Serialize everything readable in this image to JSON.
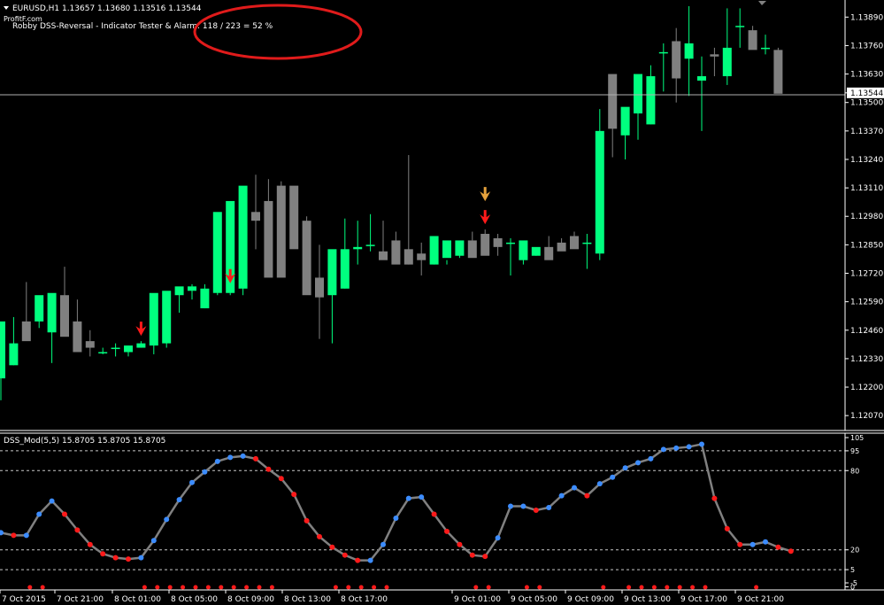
{
  "header": {
    "symbol_info": "EURUSD,H1  1.13657 1.13680 1.13516 1.13544",
    "watermark": "ProfitF.com",
    "indicator_text": "Robby DSS-Reversal - Indicator Tester & Alarm: 118 / 223 = 52 %"
  },
  "price_axis": {
    "labels": [
      "1.13890",
      "1.13760",
      "1.13630",
      "1.13544",
      "1.13500",
      "1.13370",
      "1.13240",
      "1.13110",
      "1.12980",
      "1.12850",
      "1.12720",
      "1.12590",
      "1.12460",
      "1.12330",
      "1.12200",
      "1.12070"
    ],
    "current_price": "1.13544"
  },
  "sub_window": {
    "title": "DSS_Mod(5,5) 15.8705 15.8705 15.8705",
    "level_labels": [
      "105",
      "95",
      "80",
      "20",
      "5",
      "-5",
      "0"
    ]
  },
  "time_axis": {
    "labels": [
      "7 Oct 2015",
      "7 Oct 21:00",
      "8 Oct 01:00",
      "8 Oct 05:00",
      "8 Oct 09:00",
      "8 Oct 13:00",
      "8 Oct 17:00",
      "9 Oct 01:00",
      "9 Oct 05:00",
      "9 Oct 09:00",
      "9 Oct 13:00",
      "9 Oct 17:00",
      "9 Oct 21:00"
    ]
  },
  "colors": {
    "background": "#000000",
    "bull": "#00ff7f",
    "bear": "#808080",
    "arrow_red": "#ff1a1a",
    "arrow_orange": "#e6a23c",
    "dss_line": "#808080",
    "dss_up": "#3c8cff",
    "dss_down": "#ff1a1a",
    "annotation_circle": "#e01b1b"
  },
  "chart_data": [
    {
      "type": "candlestick",
      "series": [
        {
          "open": [
            1.1224,
            1.123,
            1.125,
            1.125,
            1.1245,
            1.1262,
            1.125,
            1.1241,
            1.1236,
            1.1238,
            1.1236,
            1.1238,
            1.1239,
            1.124,
            1.1262,
            1.1264,
            1.1256,
            1.1263,
            1.1263,
            1.1265,
            1.13,
            1.1305,
            1.1312,
            1.1312,
            1.1296,
            1.127,
            1.1262,
            1.1265,
            1.1283,
            1.1285,
            1.1282,
            1.1287,
            1.1283,
            1.1281,
            1.1276,
            1.1279,
            1.128,
            1.1287,
            1.129,
            1.1288,
            1.1286,
            1.1278,
            1.128,
            1.1284,
            1.1286,
            1.1289,
            1.1286,
            1.1281,
            1.1363,
            1.1335,
            1.1345,
            1.134,
            1.1373,
            1.1378,
            1.137,
            1.136,
            1.1372,
            1.1362,
            1.1385,
            1.1383,
            1.1375,
            1.1374
          ],
          "high": [
            1.1232,
            1.1252,
            1.1268,
            1.1258,
            1.1254,
            1.1275,
            1.126,
            1.1246,
            1.1238,
            1.124,
            1.1239,
            1.1241,
            1.124,
            1.1244,
            1.1264,
            1.1267,
            1.1267,
            1.1266,
            1.1265,
            1.1311,
            1.1317,
            1.1315,
            1.1314,
            1.1306,
            1.1298,
            1.1285,
            1.1275,
            1.1297,
            1.1296,
            1.1299,
            1.1296,
            1.1291,
            1.1326,
            1.1286,
            1.1283,
            1.1278,
            1.1283,
            1.1291,
            1.1292,
            1.129,
            1.1288,
            1.1283,
            1.1283,
            1.1289,
            1.1288,
            1.1291,
            1.129,
            1.1347,
            1.1355,
            1.1345,
            1.1347,
            1.1367,
            1.1377,
            1.1384,
            1.1394,
            1.1371,
            1.1375,
            1.1393,
            1.1393,
            1.1385,
            1.1381,
            1.1375
          ],
          "low": [
            1.1214,
            1.123,
            1.1244,
            1.1247,
            1.1231,
            1.1258,
            1.124,
            1.1234,
            1.1235,
            1.1234,
            1.1234,
            1.1238,
            1.1235,
            1.1238,
            1.1254,
            1.126,
            1.1256,
            1.1262,
            1.1262,
            1.1262,
            1.1283,
            1.1293,
            1.1296,
            1.1302,
            1.1285,
            1.1242,
            1.124,
            1.1265,
            1.1276,
            1.1282,
            1.128,
            1.1283,
            1.1276,
            1.1271,
            1.1276,
            1.1276,
            1.1279,
            1.1287,
            1.1284,
            1.128,
            1.1271,
            1.1276,
            1.128,
            1.1281,
            1.1284,
            1.1286,
            1.1274,
            1.1278,
            1.1325,
            1.1324,
            1.1333,
            1.134,
            1.1355,
            1.135,
            1.1353,
            1.1337,
            1.1362,
            1.1358,
            1.1375,
            1.1375,
            1.1372,
            1.1355
          ],
          "close": [
            1.125,
            1.124,
            1.1241,
            1.1262,
            1.1263,
            1.1243,
            1.1236,
            1.1238,
            1.1236,
            1.1238,
            1.1239,
            1.124,
            1.1263,
            1.1264,
            1.1266,
            1.1266,
            1.1265,
            1.13,
            1.1305,
            1.1312,
            1.1296,
            1.127,
            1.127,
            1.1283,
            1.1262,
            1.1261,
            1.1283,
            1.1283,
            1.1284,
            1.1285,
            1.1278,
            1.1276,
            1.1276,
            1.1278,
            1.1289,
            1.1287,
            1.1287,
            1.1279,
            1.128,
            1.1284,
            1.1286,
            1.1287,
            1.1284,
            1.1278,
            1.1282,
            1.1283,
            1.1286,
            1.1337,
            1.1338,
            1.1348,
            1.1363,
            1.1362,
            1.1373,
            1.1361,
            1.1377,
            1.1362,
            1.1371,
            1.1375,
            1.1385,
            1.1374,
            1.1375,
            1.1354
          ]
        }
      ],
      "ylim": [
        1.1201,
        1.1396
      ],
      "signal_arrows": [
        {
          "bar": 11,
          "color": "red"
        },
        {
          "bar": 18,
          "color": "red"
        },
        {
          "bar": 38,
          "color": "red"
        },
        {
          "bar": 38,
          "color": "orange"
        }
      ],
      "grid": false
    },
    {
      "type": "line",
      "name": "DSS_Mod(5,5)",
      "values": [
        33,
        31,
        31,
        47,
        57,
        47,
        35,
        24,
        17,
        14,
        13,
        14,
        27,
        43,
        58,
        71,
        79,
        87,
        90,
        91,
        89,
        81,
        74,
        62,
        42,
        30,
        22,
        16,
        12,
        12,
        24,
        44,
        59,
        60,
        47,
        34,
        24,
        16,
        15,
        29,
        53,
        53,
        50,
        52,
        61,
        67,
        61,
        70,
        75,
        82,
        86,
        89,
        96,
        97,
        98,
        100,
        59,
        36,
        24,
        24,
        26,
        22,
        19
      ],
      "ylim": [
        -5,
        105
      ],
      "levels": [
        95,
        80,
        20,
        5
      ],
      "grid": false
    }
  ]
}
